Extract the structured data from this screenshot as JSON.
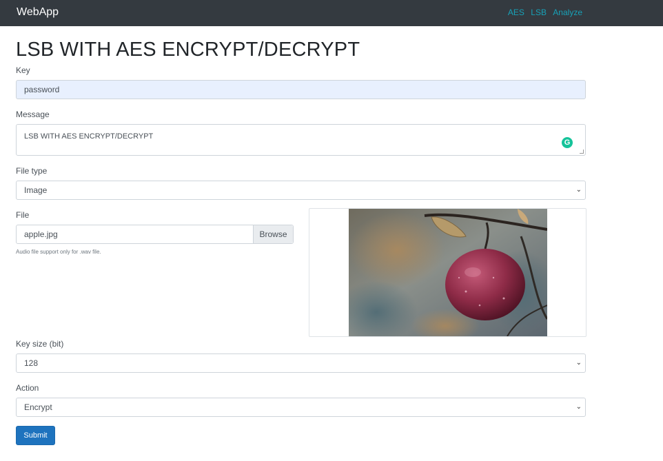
{
  "navbar": {
    "brand": "WebApp",
    "links": [
      "AES",
      "LSB",
      "Analyze"
    ]
  },
  "page_title": "LSB WITH AES ENCRYPT/DECRYPT",
  "form": {
    "key_label": "Key",
    "key_value": "password",
    "message_label": "Message",
    "message_value": "LSB WITH AES ENCRYPT/DECRYPT",
    "file_type_label": "File type",
    "file_type_value": "Image",
    "file_label": "File",
    "file_value": "apple.jpg",
    "browse_label": "Browse",
    "file_help": "Audio file support only for .wav file.",
    "key_size_label": "Key size (bit)",
    "key_size_value": "128",
    "action_label": "Action",
    "action_value": "Encrypt",
    "submit_label": "Submit"
  },
  "icons": {
    "grammarly": "grammarly-icon",
    "dropdown": "chevron-down-icon"
  },
  "colors": {
    "navbar_bg": "#343a40",
    "nav_link": "#17a2b8",
    "primary": "#1e73be",
    "autofill_bg": "#e8f0fe"
  }
}
